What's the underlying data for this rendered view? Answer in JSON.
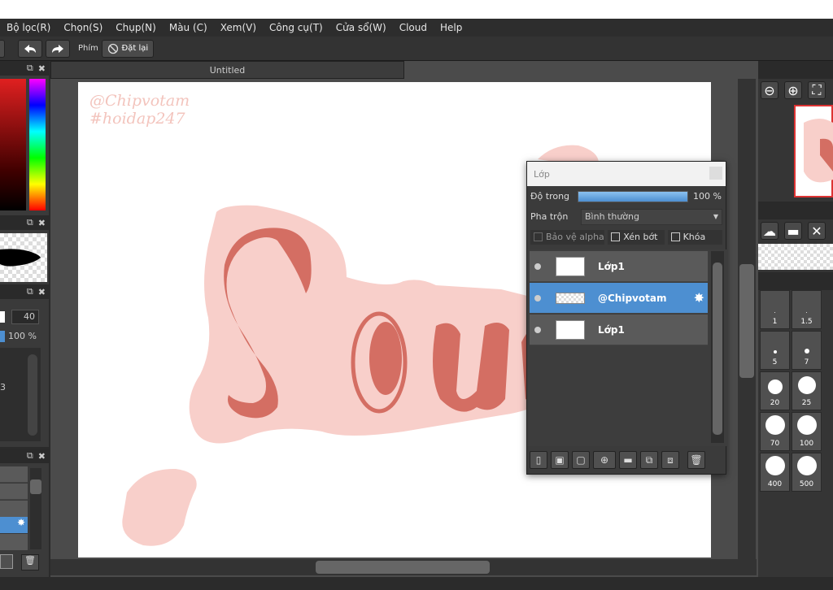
{
  "menu": {
    "items": [
      "Bộ lọc(R)",
      "Chọn(S)",
      "Chụp(N)",
      "Màu (C)",
      "Xem(V)",
      "Công cụ(T)",
      "Cửa sổ(W)",
      "Cloud",
      "Help"
    ]
  },
  "toolbar": {
    "key_label": "Phím",
    "reset_label": "Đặt lại"
  },
  "document": {
    "tab_title": "Untitled",
    "watermark_line1": "@Chipvotam",
    "watermark_line2": "#hoidap247",
    "art_text": "Sou"
  },
  "left_panel": {
    "brush_size": "40",
    "opacity": "100 %",
    "partial_value": "3"
  },
  "layer_window": {
    "title": "Lớp",
    "opacity_label": "Độ trong",
    "opacity_value": "100 %",
    "opacity_fraction": 1.0,
    "blend_label": "Pha trộn",
    "blend_value": "Bình thường",
    "protect_alpha": "Bảo vệ alpha",
    "clipping": "Xén bớt",
    "lock": "Khóa",
    "layers": [
      {
        "name": "Lớp1",
        "selected": false
      },
      {
        "name": "@Chipvotam",
        "selected": true
      },
      {
        "name": "Lớp1",
        "selected": false
      }
    ]
  },
  "right_panel": {
    "brush_sizes": [
      "1",
      "1.5",
      "5",
      "7",
      "20",
      "25",
      "70",
      "100",
      "400",
      "500"
    ]
  },
  "colors": {
    "accent": "#4d8fd1",
    "artwork_main": "#d46e63",
    "artwork_bg": "#f8cfca"
  }
}
